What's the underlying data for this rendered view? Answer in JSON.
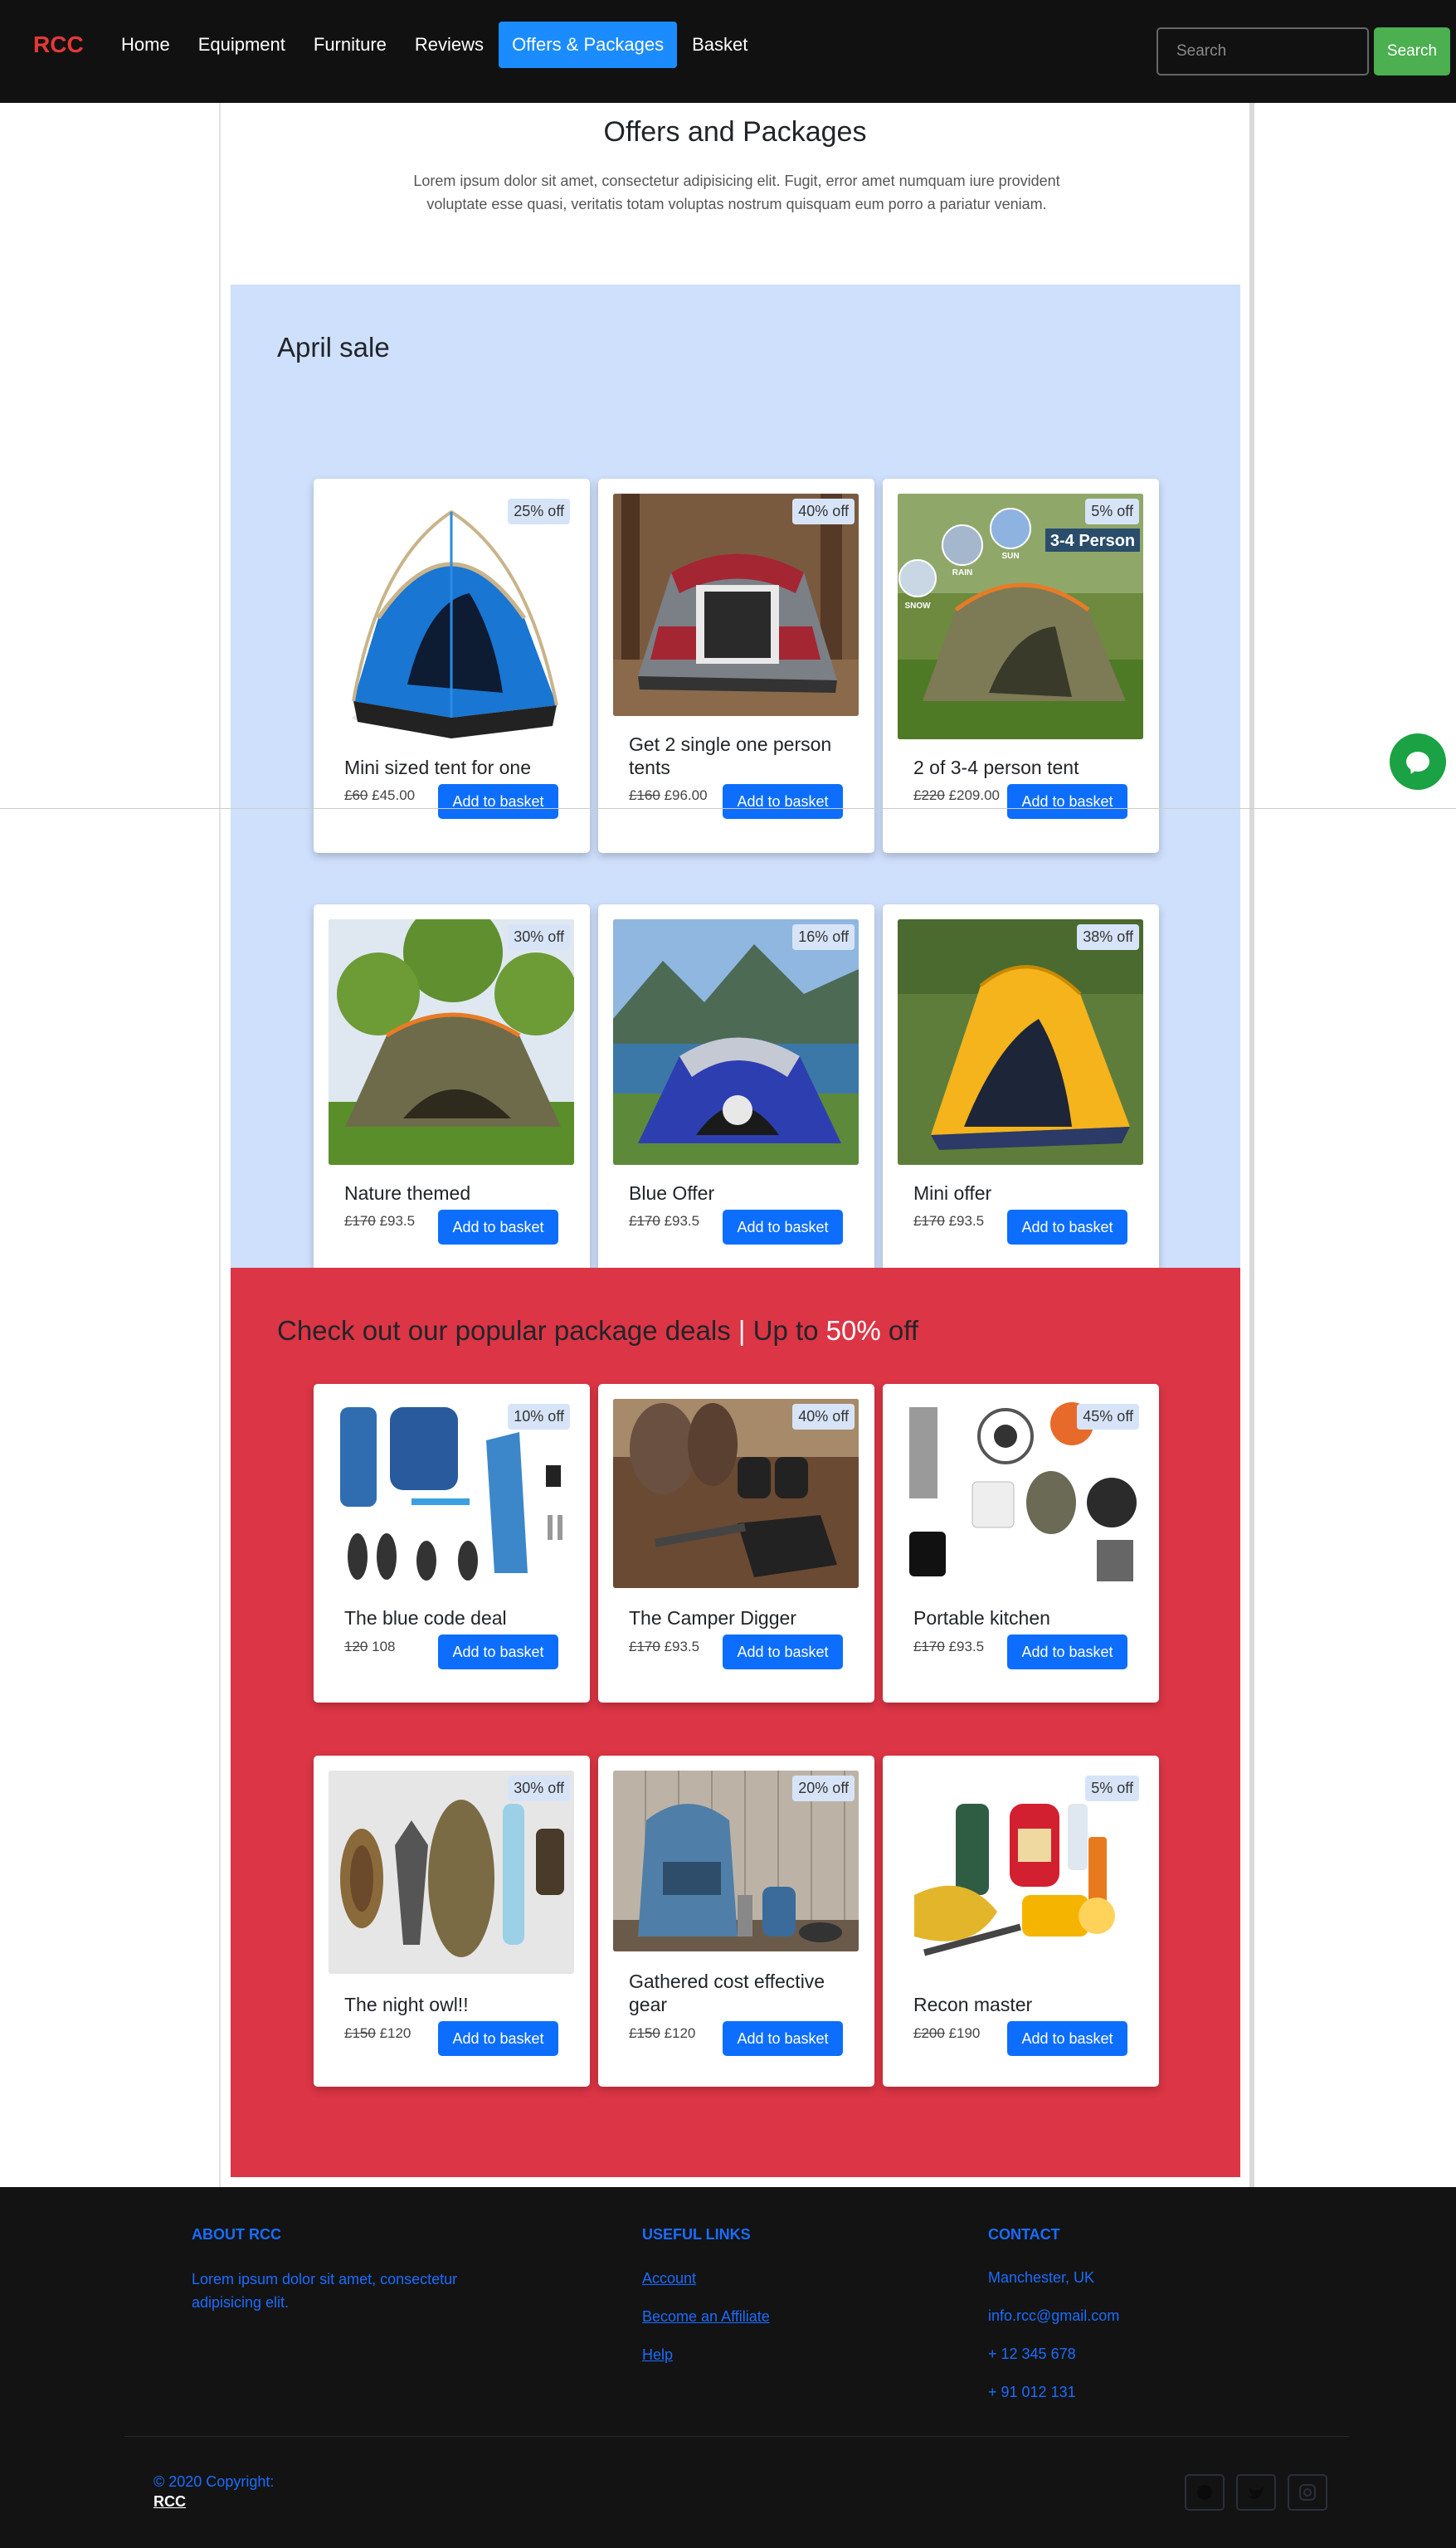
{
  "nav": {
    "brand": "RCC",
    "links": [
      "Home",
      "Equipment",
      "Furniture",
      "Reviews",
      "Offers & Packages",
      "Basket"
    ],
    "search_placeholder": "Search",
    "search_button": "Search"
  },
  "page": {
    "title": "Offers and Packages",
    "intro": "Lorem ipsum dolor sit amet, consectetur adipisicing elit. Fugit, error amet numquam iure provident voluptate esse quasi, veritatis totam voluptas nostrum quisquam eum porro a pariatur veniam."
  },
  "april_sale": {
    "heading": "April sale",
    "products": [
      {
        "title": "Mini sized tent for one",
        "old_price": "£60",
        "new_price": "£45.00",
        "discount": "25% off",
        "button": "Add to basket",
        "image": "blue-dome-tent"
      },
      {
        "title": "Get 2 single one person tents",
        "old_price": "£160",
        "new_price": "£96.00",
        "discount": "40% off",
        "button": "Add to basket",
        "image": "grey-red-cabin-tent-forest"
      },
      {
        "title": "2 of 3-4 person tent",
        "old_price": "£220",
        "new_price": "£209.00",
        "discount": "5% off",
        "button": "Add to basket",
        "image": "olive-tent-3-4-person",
        "image_text": {
          "capacity": "3-4 Person",
          "rain": "RAIN",
          "sun": "SUN",
          "snow": "SNOW"
        }
      },
      {
        "title": "Nature themed",
        "old_price": "£170",
        "new_price": "£93.5",
        "discount": "30% off",
        "button": "Add to basket",
        "image": "olive-tent-garden"
      },
      {
        "title": "Blue Offer",
        "old_price": "£170",
        "new_price": "£93.5",
        "discount": "16% off",
        "button": "Add to basket",
        "image": "blue-tent-lake-mountains"
      },
      {
        "title": "Mini offer",
        "old_price": "£170",
        "new_price": "£93.5",
        "discount": "38% off",
        "button": "Add to basket",
        "image": "yellow-dome-tent"
      }
    ]
  },
  "package_deals": {
    "heading_main": "Check out our popular package deals",
    "heading_separator": "|",
    "heading_up_to": "Up to",
    "heading_percent": "50%",
    "heading_off": "off",
    "products": [
      {
        "title": "The blue code deal",
        "old_price": "120",
        "new_price": "108",
        "discount": "10% off",
        "button": "Add to basket",
        "image": "blue-gear-flatlay"
      },
      {
        "title": "The Camper Digger",
        "old_price": "£170",
        "new_price": "£93.5",
        "discount": "40% off",
        "button": "Add to basket",
        "image": "boots-binoculars-shovel"
      },
      {
        "title": "Portable kitchen",
        "old_price": "£170",
        "new_price": "£93.5",
        "discount": "45% off",
        "button": "Add to basket",
        "image": "cooking-kit-flatlay"
      },
      {
        "title": "The night owl!!",
        "old_price": "£150",
        "new_price": "£120",
        "discount": "30% off",
        "button": "Add to basket",
        "image": "hat-backpack-lantern"
      },
      {
        "title": "Gathered cost effective gear",
        "old_price": "£150",
        "new_price": "£120",
        "discount": "20% off",
        "button": "Add to basket",
        "image": "backpack-on-wood"
      },
      {
        "title": "Recon master",
        "old_price": "£200",
        "new_price": "£190",
        "discount": "5% off",
        "button": "Add to basket",
        "image": "lantern-survival-kit"
      }
    ]
  },
  "footer": {
    "about_title": "ABOUT RCC",
    "about_text": "Lorem ipsum dolor sit amet, consectetur adipisicing elit.",
    "links_title": "USEFUL LINKS",
    "links": [
      "Account",
      "Become an Affiliate",
      "Help"
    ],
    "contact_title": "CONTACT",
    "contact": [
      "Manchester, UK",
      "info.rcc@gmail.com",
      "+ 12 345 678",
      "+ 91 012 131"
    ],
    "copyright": "© 2020 Copyright:",
    "copyright_brand": "RCC",
    "social": [
      "facebook-icon",
      "twitter-icon",
      "instagram-icon"
    ]
  },
  "colors": {
    "brand": "#e53935",
    "nav_bg": "#111111",
    "active_nav": "#1a8cff",
    "sale_bg": "#cfe0fc",
    "deals_bg": "#dc3545",
    "button": "#0d6efd",
    "search_button": "#4caf50",
    "footer_text": "#1a6cff",
    "chat": "#1aa244"
  }
}
